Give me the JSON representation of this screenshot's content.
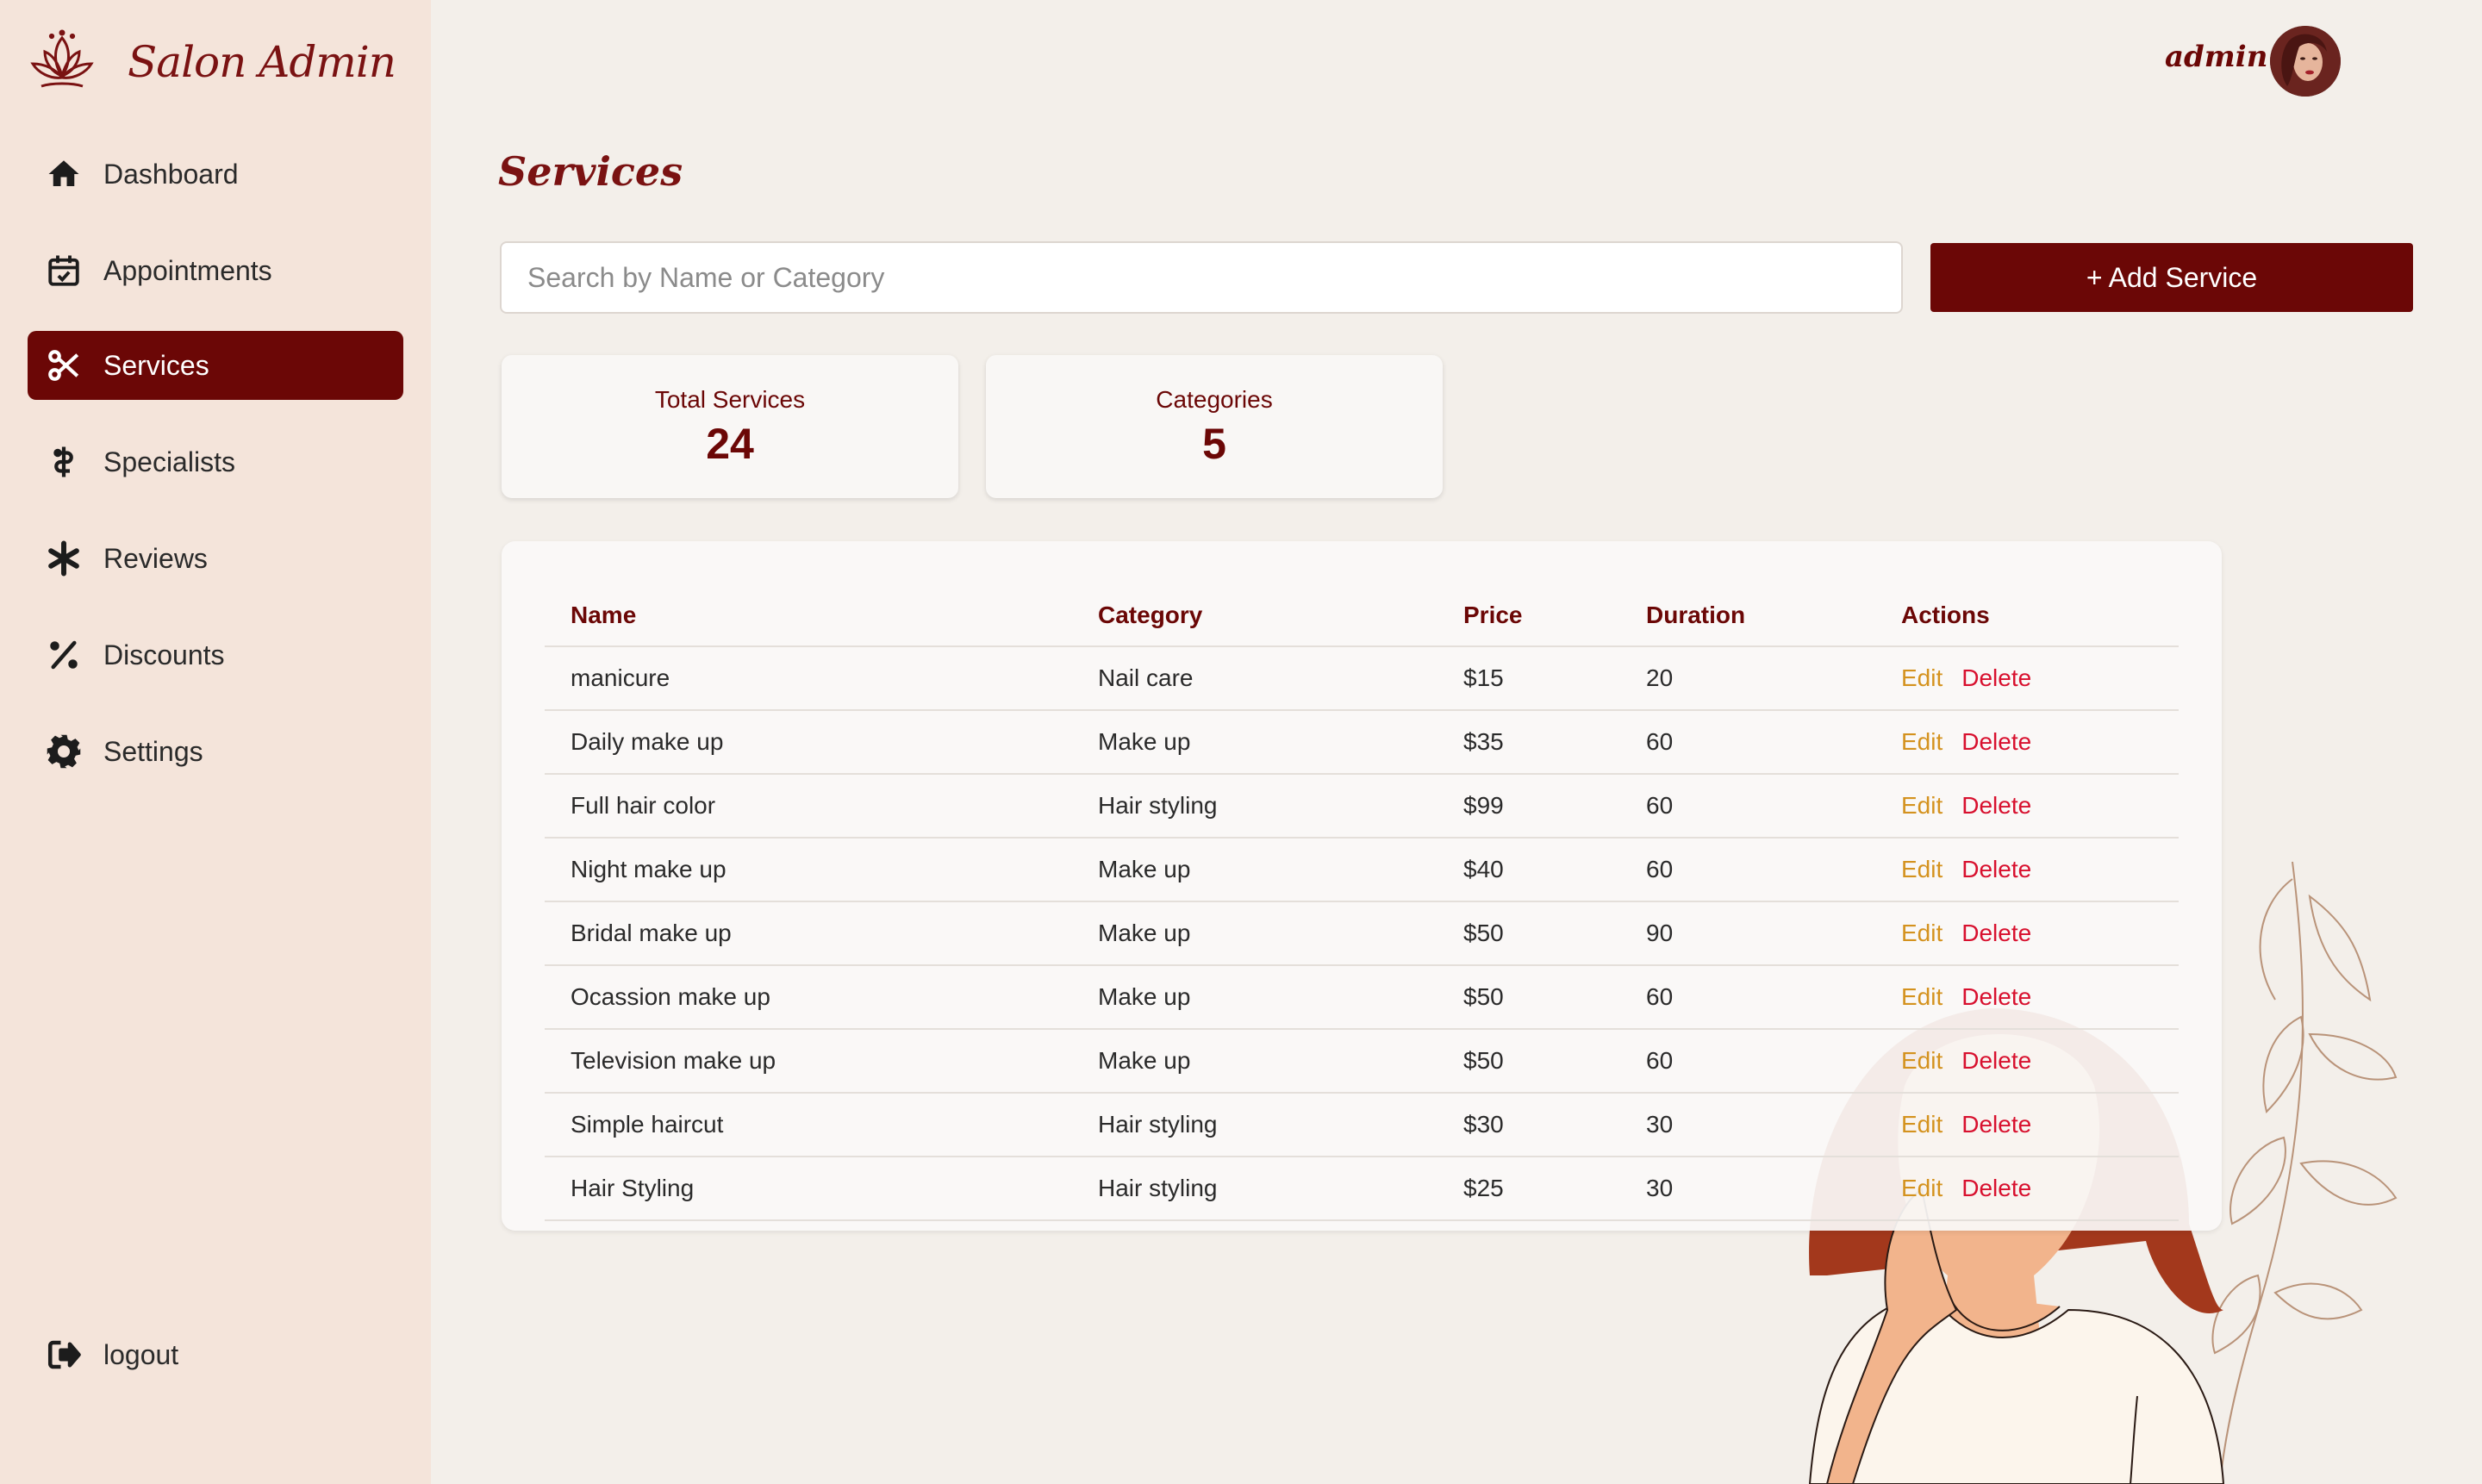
{
  "brand": {
    "name": "Salon Admin",
    "logo_icon": "lotus-icon"
  },
  "sidebar": {
    "items": [
      {
        "label": "Dashboard",
        "icon": "home-icon"
      },
      {
        "label": "Appointments",
        "icon": "calendar-check-icon"
      },
      {
        "label": "Services",
        "icon": "scissors-icon",
        "active": true
      },
      {
        "label": "Specialists",
        "icon": "staff-icon"
      },
      {
        "label": "Reviews",
        "icon": "asterisk-icon"
      },
      {
        "label": "Discounts",
        "icon": "percent-icon"
      },
      {
        "label": "Settings",
        "icon": "gear-icon"
      }
    ],
    "logout_label": "logout"
  },
  "header": {
    "user_name": "admin"
  },
  "page": {
    "title": "Services"
  },
  "search": {
    "placeholder": "Search by Name or Category",
    "value": ""
  },
  "toolbar": {
    "add_label": "+ Add Service"
  },
  "stats": [
    {
      "label": "Total Services",
      "value": "24"
    },
    {
      "label": "Categories",
      "value": "5"
    }
  ],
  "table": {
    "headers": [
      "Name",
      "Category",
      "Price",
      "Duration",
      "Actions"
    ],
    "rows": [
      {
        "name": "manicure",
        "category": "Nail care",
        "price": "$15",
        "duration": "20"
      },
      {
        "name": "Daily make up",
        "category": "Make up",
        "price": "$35",
        "duration": "60"
      },
      {
        "name": "Full hair color",
        "category": "Hair styling",
        "price": "$99",
        "duration": "60"
      },
      {
        "name": "Night make up",
        "category": "Make up",
        "price": "$40",
        "duration": "60"
      },
      {
        "name": "Bridal make up",
        "category": "Make up",
        "price": "$50",
        "duration": "90"
      },
      {
        "name": "Ocassion make up",
        "category": "Make up",
        "price": "$50",
        "duration": "60"
      },
      {
        "name": "Television make up",
        "category": "Make up",
        "price": "$50",
        "duration": "60"
      },
      {
        "name": "Simple haircut",
        "category": "Hair styling",
        "price": "$30",
        "duration": "30"
      },
      {
        "name": "Hair Styling",
        "category": "Hair styling",
        "price": "$25",
        "duration": "30"
      }
    ],
    "edit_label": "Edit",
    "delete_label": "Delete"
  },
  "colors": {
    "accent": "#6b0706",
    "sidebar_bg": "#f4e4da",
    "page_bg": "#f3efea",
    "edit": "#d4921e",
    "delete": "#d8102e"
  }
}
